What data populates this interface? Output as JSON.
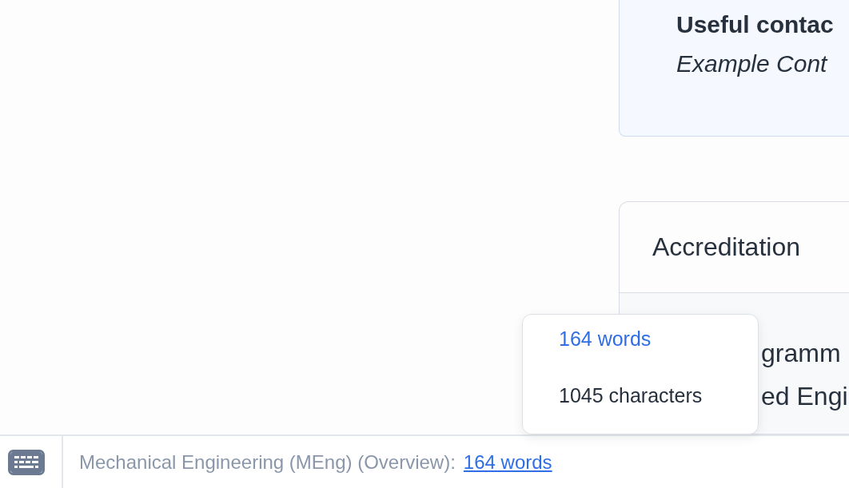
{
  "contact_card": {
    "title": "Useful contac",
    "subtitle": "Example Cont"
  },
  "accreditation_card": {
    "title": "Accreditation",
    "lines": [
      "gramm",
      "ed Engi"
    ]
  },
  "count_menu": {
    "items": [
      {
        "label": "164 words",
        "selected": true
      },
      {
        "label": "1045 characters",
        "selected": false
      }
    ]
  },
  "status_bar": {
    "document": "Mechanical Engineering (MEng) (Overview):",
    "count_link": "164 words"
  }
}
